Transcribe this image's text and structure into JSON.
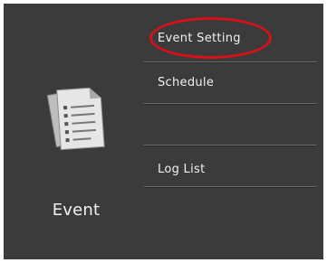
{
  "event": {
    "label": "Event",
    "icon": "document-list-icon"
  },
  "menu": {
    "items": [
      {
        "label": "Event Setting",
        "highlighted": true
      },
      {
        "label": "Schedule"
      },
      {
        "label": ""
      },
      {
        "label": "Log List"
      }
    ]
  },
  "colors": {
    "panel_bg": "#3b3b3b",
    "text": "#f0f0f0",
    "highlight": "#d8101a"
  }
}
